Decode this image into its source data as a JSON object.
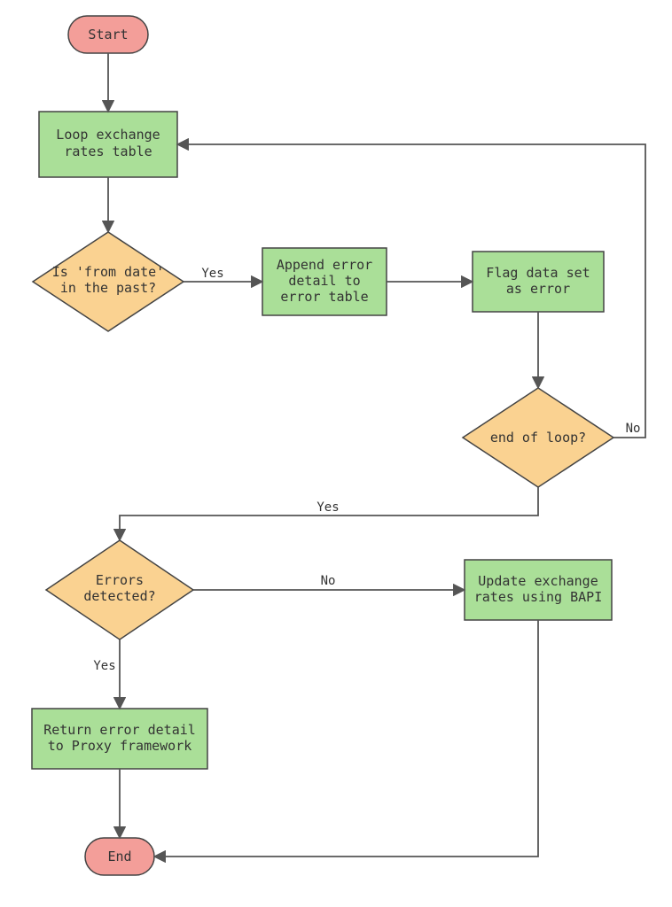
{
  "diagram": {
    "nodes": {
      "start": {
        "label": "Start"
      },
      "loop": {
        "line1": "Loop exchange",
        "line2": "rates table"
      },
      "check_date": {
        "line1": "Is 'from date'",
        "line2": "in the past?"
      },
      "append_err": {
        "line1": "Append error",
        "line2": "detail to",
        "line3": "error table"
      },
      "flag_err": {
        "line1": "Flag data set",
        "line2": "as error"
      },
      "end_loop": {
        "label": "end of loop?"
      },
      "errors_detected": {
        "line1": "Errors",
        "line2": "detected?"
      },
      "return_err": {
        "line1": "Return error detail",
        "line2": "to Proxy framework"
      },
      "update_bapi": {
        "line1": "Update exchange",
        "line2": "rates using BAPI"
      },
      "end": {
        "label": "End"
      }
    },
    "edges": {
      "yes1": "Yes",
      "no1": "No",
      "yes2": "Yes",
      "no2": "No",
      "yes3": "Yes"
    }
  },
  "colors": {
    "terminal_fill": "#f39e99",
    "process_fill": "#aadf98",
    "decision_fill": "#fad291",
    "stroke": "#444444",
    "edge": "#555555"
  }
}
